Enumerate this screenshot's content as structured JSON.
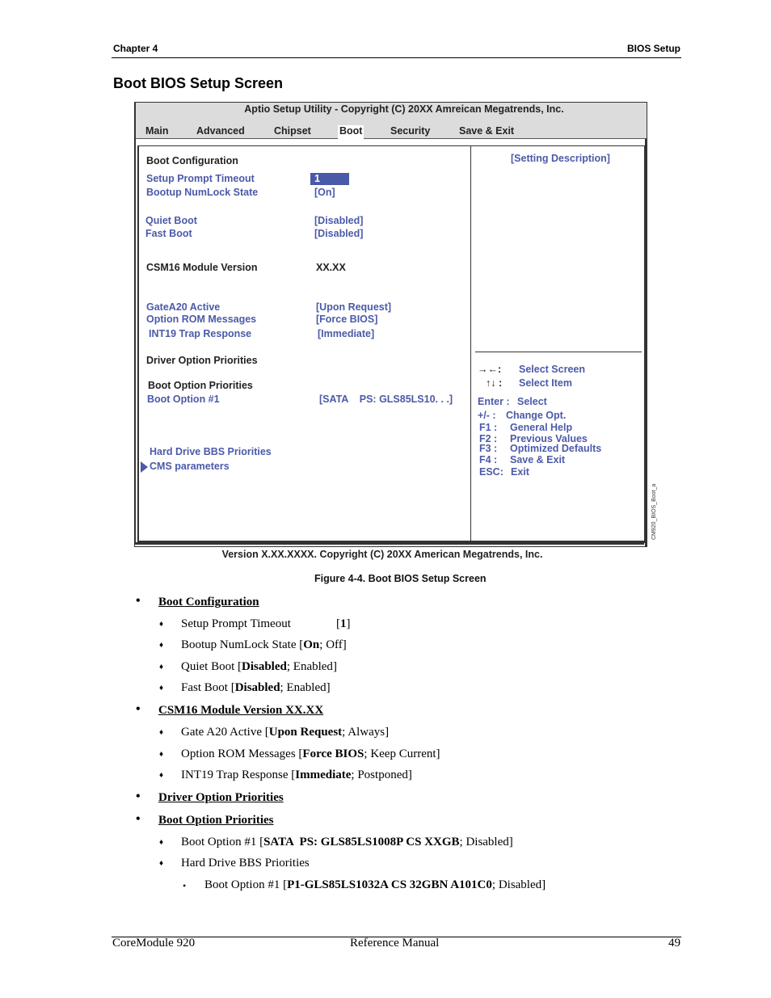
{
  "page_header": {
    "chapter": "Chapter 4",
    "section": "BIOS Setup"
  },
  "section_title": "Boot BIOS Setup Screen",
  "bios": {
    "title": "Aptio Setup Utility - Copyright (C) 20XX Amreican Megatrends, Inc.",
    "tabs": [
      {
        "label": "Main",
        "active": false
      },
      {
        "label": "Advanced",
        "active": false
      },
      {
        "label": "Chipset",
        "active": false
      },
      {
        "label": "Boot",
        "active": true
      },
      {
        "label": "Security",
        "active": false
      },
      {
        "label": "Save & Exit",
        "active": false
      }
    ],
    "settings": {
      "boot_configuration": "Boot Configuration",
      "setup_prompt_timeout": {
        "label": "Setup Prompt Timeout",
        "value": "1"
      },
      "bootup_numlock_state": {
        "label": "Bootup NumLock State",
        "value": "[On]"
      },
      "quiet_boot": {
        "label": "Quiet Boot",
        "value": "[Disabled]"
      },
      "fast_boot": {
        "label": "Fast Boot",
        "value": "[Disabled]"
      },
      "csm16_module_version": {
        "label": "CSM16 Module Version",
        "value": "XX.XX"
      },
      "gatea20_active": {
        "label": "GateA20 Active",
        "value": "[Upon Request]"
      },
      "option_rom_messages": {
        "label": "Option ROM Messages",
        "value": "[Force BIOS]"
      },
      "int19_trap_response": {
        "label": "INT19 Trap Response",
        "value": "[Immediate]"
      },
      "driver_option_priorities": "Driver Option Priorities",
      "boot_option_priorities": "Boot Option Priorities",
      "boot_option_1": {
        "label": "Boot Option #1",
        "value": "[SATA    PS: GLS85LS10. . .]"
      },
      "hard_drive_bbs_priorities": "Hard Drive BBS Priorities",
      "cms_parameters": "CMS parameters"
    },
    "help": {
      "description": "[Setting Description]",
      "keys": [
        {
          "key": "→←:",
          "action": "Select Screen"
        },
        {
          "key": "↑↓ :",
          "action": "Select Item"
        },
        {
          "key": "Enter :",
          "action": "Select"
        },
        {
          "key": "+/- :",
          "action": "Change Opt."
        },
        {
          "key": "F1 :",
          "action": "General Help"
        },
        {
          "key": "F2 :",
          "action": "Previous Values"
        },
        {
          "key": "F3 :",
          "action": "Optimized Defaults"
        },
        {
          "key": "F4 :",
          "action": "Save & Exit"
        },
        {
          "key": "ESC:",
          "action": "Exit"
        }
      ]
    },
    "side_tag": "CM920_BIOS_Boot_a",
    "footer": "Version X.XX.XXXX.  Copyright (C) 20XX  American Megatrends, Inc."
  },
  "figure_caption": "Figure  4-4.   Boot BIOS Setup Screen",
  "doc_list": {
    "boot_configuration": {
      "heading": "Boot Configuration",
      "items": [
        {
          "name": "Setup Prompt Timeout",
          "default": "1",
          "others": ""
        },
        {
          "name": "Bootup NumLock State",
          "default": "On",
          "others": "Off"
        },
        {
          "name": "Quiet Boot",
          "default": "Disabled",
          "others": "Enabled"
        },
        {
          "name": "Fast Boot",
          "default": "Disabled",
          "others": "Enabled"
        }
      ]
    },
    "csm16": {
      "heading": "CSM16 Module Version XX.XX",
      "items": [
        {
          "name": "Gate A20 Active",
          "default": "Upon Request",
          "others": "Always"
        },
        {
          "name": "Option ROM Messages",
          "default": "Force BIOS",
          "others": "Keep Current"
        },
        {
          "name": "INT19 Trap Response",
          "default": "Immediate",
          "others": "Postponed"
        }
      ]
    },
    "driver_option_priorities": {
      "heading": "Driver Option Priorities"
    },
    "boot_option_priorities": {
      "heading": "Boot Option Priorities",
      "items": [
        {
          "name": "Boot Option #1",
          "default": "SATA  PS: GLS85LS1008P CS XXGB",
          "others": "Disabled"
        },
        {
          "name": "Hard Drive BBS Priorities"
        }
      ],
      "sub_items": [
        {
          "name": "Boot Option #1",
          "default": "P1-GLS85LS1032A CS 32GBN A101C0",
          "others": "Disabled"
        }
      ]
    }
  },
  "page_footer": {
    "product": "CoreModule 920",
    "doc": "Reference Manual",
    "page": "49"
  },
  "colors": {
    "bios_accent": "#4b5aa8",
    "bios_topbar": "#dcdcdc"
  }
}
